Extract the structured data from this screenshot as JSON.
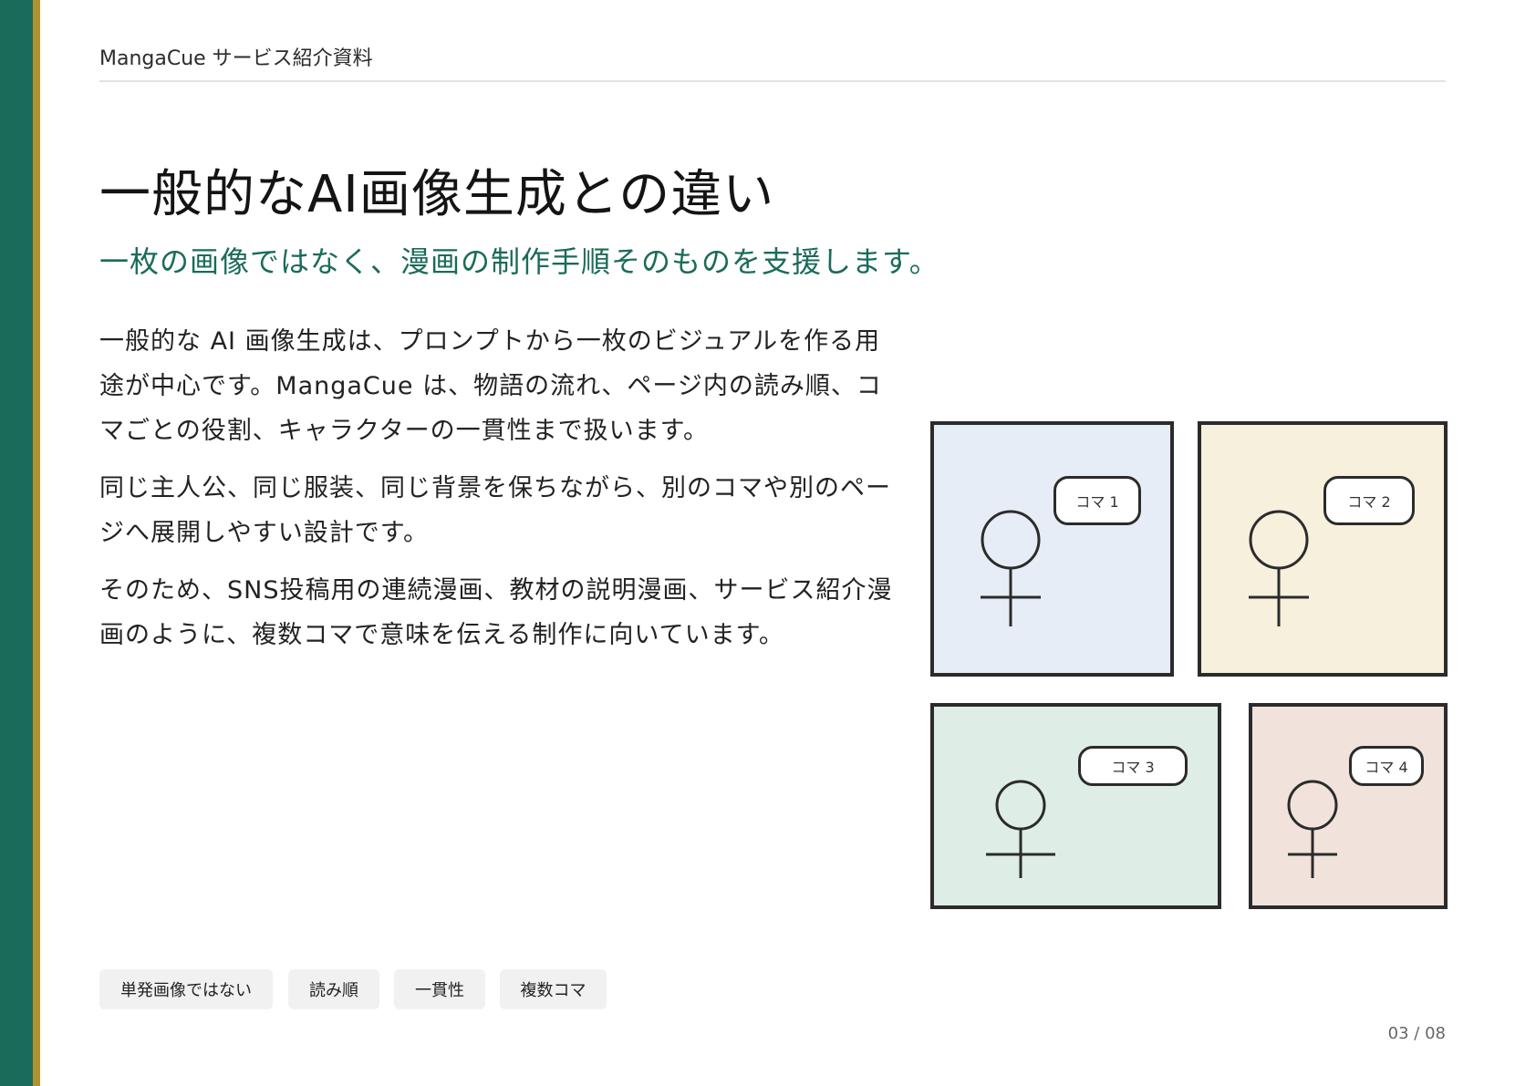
{
  "header": {
    "title": "MangaCue サービス紹介資料"
  },
  "title": "一般的なAI画像生成との違い",
  "subtitle": "一枚の画像ではなく、漫画の制作手順そのものを支援します。",
  "body": {
    "paragraphs": [
      "一般的な AI 画像生成は、プロンプトから一枚のビジュアルを作る用途が中心です。MangaCue は、物語の流れ、ページ内の読み順、コマごとの役割、キャラクターの一貫性まで扱います。",
      "同じ主人公、同じ服装、同じ背景を保ちながら、別のコマや別のページへ展開しやすい設計です。",
      "そのため、SNS投稿用の連続漫画、教材の説明漫画、サービス紹介漫画のように、複数コマで意味を伝える制作に向いています。"
    ]
  },
  "illustration": {
    "panels": [
      {
        "label": "コマ 1",
        "color": "#e6edf6"
      },
      {
        "label": "コマ 2",
        "color": "#f6f0dc"
      },
      {
        "label": "コマ 3",
        "color": "#deeee7"
      },
      {
        "label": "コマ 4",
        "color": "#f1e3dc"
      }
    ]
  },
  "tags": [
    "単発画像ではない",
    "読み順",
    "一貫性",
    "複数コマ"
  ],
  "page_number": "03 / 08",
  "colors": {
    "brand_green": "#1a6b5a",
    "accent_gold": "#b0922f"
  }
}
